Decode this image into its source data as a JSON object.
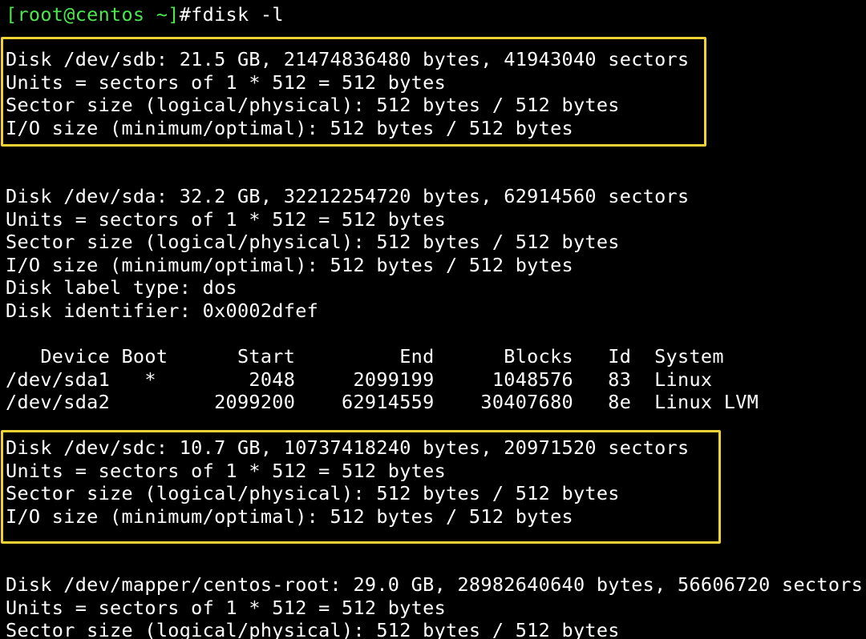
{
  "colors": {
    "background": "#000000",
    "text": "#ffffff",
    "prompt": "#4ee64e",
    "highlight_border": "#f0d232"
  },
  "prompt": "[root@centos ~]",
  "command": "#fdisk -l",
  "sdb": {
    "disk": "Disk /dev/sdb: 21.5 GB, 21474836480 bytes, 41943040 sectors",
    "units": "Units = sectors of 1 * 512 = 512 bytes",
    "sector_size": "Sector size (logical/physical): 512 bytes / 512 bytes",
    "io_size": "I/O size (minimum/optimal): 512 bytes / 512 bytes"
  },
  "sda": {
    "disk": "Disk /dev/sda: 32.2 GB, 32212254720 bytes, 62914560 sectors",
    "units": "Units = sectors of 1 * 512 = 512 bytes",
    "sector_size": "Sector size (logical/physical): 512 bytes / 512 bytes",
    "io_size": "I/O size (minimum/optimal): 512 bytes / 512 bytes",
    "label_type": "Disk label type: dos",
    "identifier": "Disk identifier: 0x0002dfef",
    "partition_header": "   Device Boot      Start         End      Blocks   Id  System",
    "partitions": [
      "/dev/sda1   *        2048     2099199     1048576   83  Linux",
      "/dev/sda2         2099200    62914559    30407680   8e  Linux LVM"
    ]
  },
  "sdc": {
    "disk": "Disk /dev/sdc: 10.7 GB, 10737418240 bytes, 20971520 sectors",
    "units": "Units = sectors of 1 * 512 = 512 bytes",
    "sector_size": "Sector size (logical/physical): 512 bytes / 512 bytes",
    "io_size": "I/O size (minimum/optimal): 512 bytes / 512 bytes"
  },
  "centos_root": {
    "disk": "Disk /dev/mapper/centos-root: 29.0 GB, 28982640640 bytes, 56606720 sectors",
    "units": "Units = sectors of 1 * 512 = 512 bytes",
    "sector_size": "Sector size (logical/physical): 512 bytes / 512 bytes"
  }
}
